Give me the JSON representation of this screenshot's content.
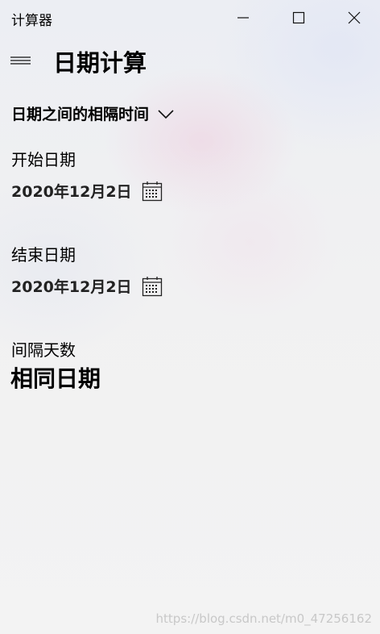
{
  "window": {
    "title": "计算器"
  },
  "header": {
    "title": "日期计算"
  },
  "mode": {
    "selected": "日期之间的相隔时间"
  },
  "from": {
    "label": "开始日期",
    "value": "2020年12月2日"
  },
  "to": {
    "label": "结束日期",
    "value": "2020年12月2日"
  },
  "difference": {
    "label": "间隔天数",
    "value": "相同日期"
  },
  "watermark": "https://blog.csdn.net/m0_47256162",
  "icons": {
    "menu": "hamburger-icon",
    "dropdown": "chevron-down-icon",
    "calendar": "calendar-icon",
    "minimize": "minimize-icon",
    "maximize": "maximize-icon",
    "close": "close-icon"
  }
}
